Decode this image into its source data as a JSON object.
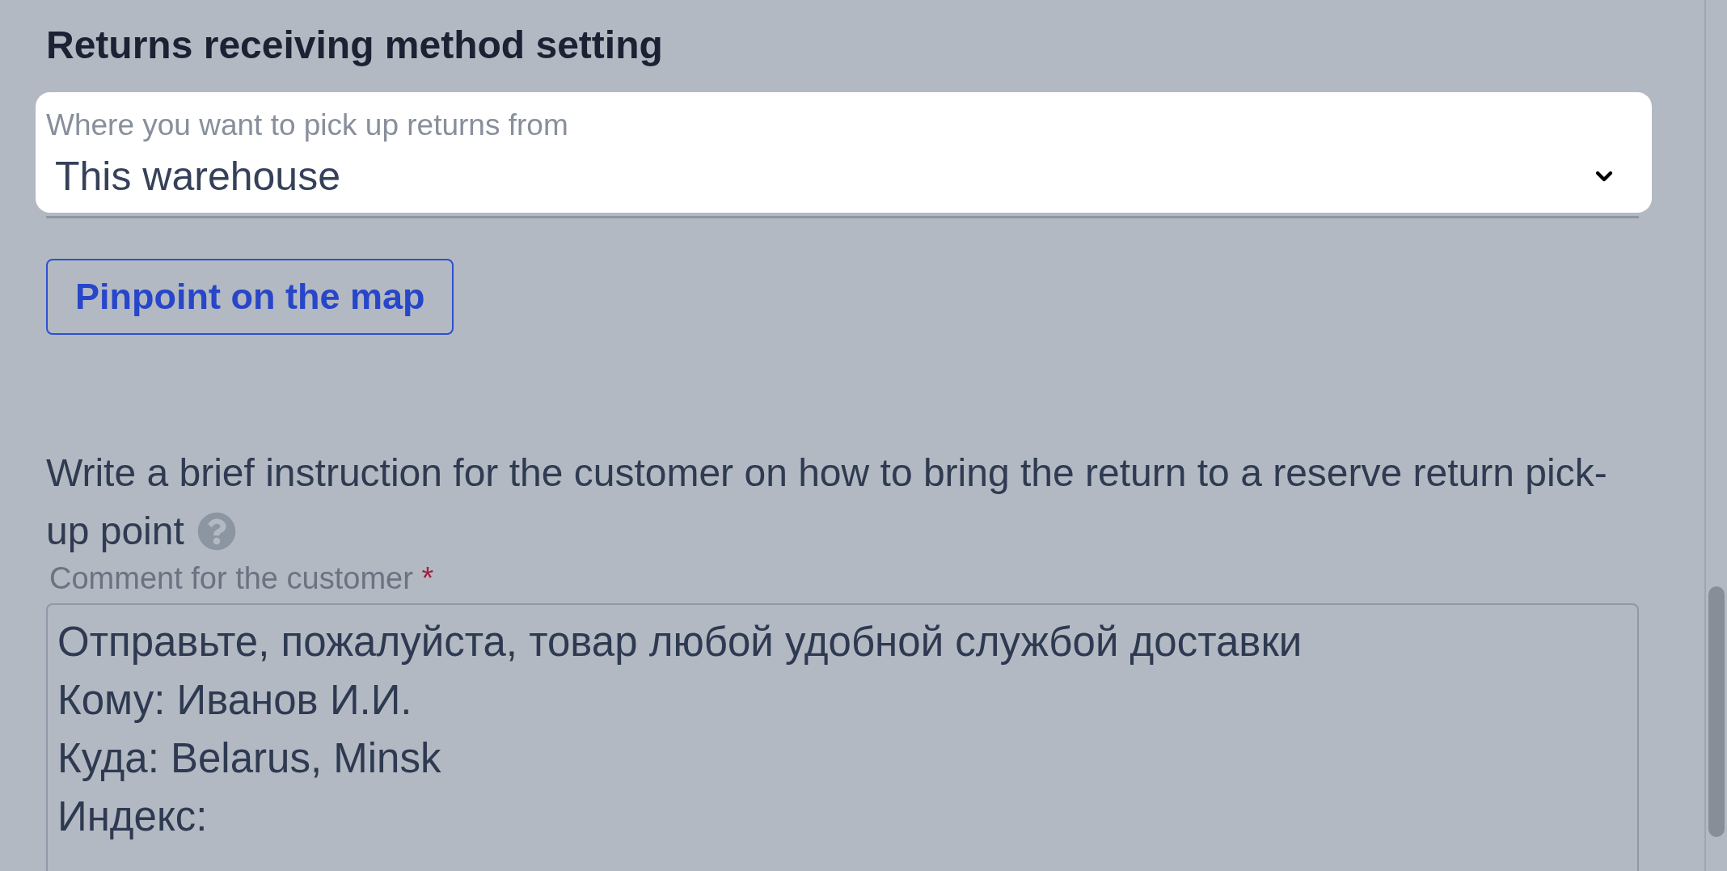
{
  "section": {
    "title": "Returns receiving method setting"
  },
  "pickup_select": {
    "label": "Where you want to pick up returns from",
    "value": "This warehouse"
  },
  "map_button": {
    "label": "Pinpoint on the map"
  },
  "instruction": {
    "text": "Write a brief instruction for the customer on how to bring the return to a reserve return pick-up point"
  },
  "comment_field": {
    "label": "Comment for the customer",
    "required_mark": "*",
    "value": "Отправьте, пожалуйста, товар любой удобной службой доставки\nКому: Иванов И.И.\nКуда: Belarus, Minsk\nИндекс:"
  }
}
